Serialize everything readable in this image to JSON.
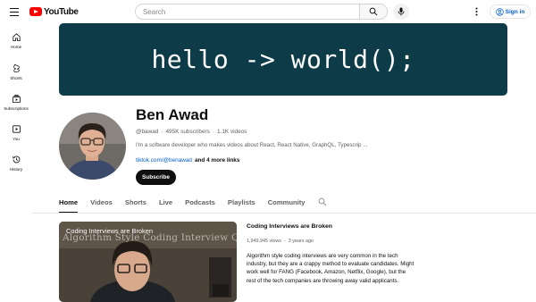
{
  "header": {
    "logo_text": "YouTube",
    "search_placeholder": "Search",
    "signin_label": "Sign in"
  },
  "sidebar": {
    "items": [
      {
        "label": "Home",
        "icon": "home-icon"
      },
      {
        "label": "Shorts",
        "icon": "shorts-icon"
      },
      {
        "label": "Subscriptions",
        "icon": "subscriptions-icon"
      },
      {
        "label": "You",
        "icon": "you-icon"
      },
      {
        "label": "History",
        "icon": "history-icon"
      }
    ]
  },
  "banner": {
    "text": "hello -> world();"
  },
  "channel": {
    "name": "Ben Awad",
    "handle": "@bawad",
    "subscribers": "495K subscribers",
    "videos": "1.1K videos",
    "separator": "·",
    "description": "I'm a software developer who makes videos about React, React Native, GraphQL, Typescrip",
    "description_more": "...",
    "link_main": "tiktok.com/@benawad",
    "link_more": "and 4 more links",
    "subscribe_label": "Subscribe"
  },
  "tabs": [
    {
      "label": "Home",
      "active": true
    },
    {
      "label": "Videos",
      "active": false
    },
    {
      "label": "Shorts",
      "active": false
    },
    {
      "label": "Live",
      "active": false
    },
    {
      "label": "Podcasts",
      "active": false
    },
    {
      "label": "Playlists",
      "active": false
    },
    {
      "label": "Community",
      "active": false
    }
  ],
  "featured": {
    "thumb_title": "Coding Interviews are Broken",
    "thumb_overlay": "Algorithm Style Coding Interview Questions",
    "title": "Coding Interviews are Broken",
    "views": "1,949,945 views",
    "age": "3 years ago",
    "separator": "·",
    "description": "Algorithm style coding interviews are very common in the tech industry, but they are a crappy method to evaluate candidates. Might work well for FANG (Facebook, Amazon, Netflix, Google), but the rest of the tech companies are throwing away valid applicants."
  },
  "colors": {
    "brand_red": "#ff0000",
    "banner_bg": "#0d3c48",
    "link_blue": "#065fd4"
  }
}
